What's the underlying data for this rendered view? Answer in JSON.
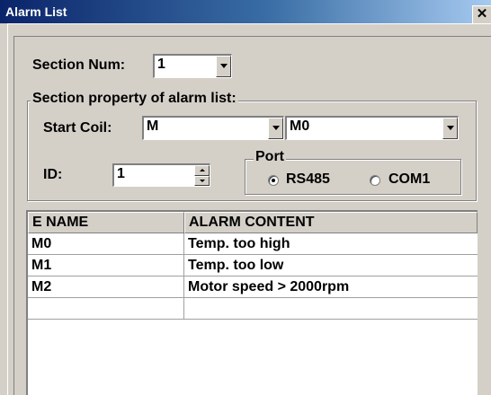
{
  "window": {
    "title": "Alarm List",
    "close_glyph": "✕"
  },
  "section_num": {
    "label": "Section Num:",
    "value": "1"
  },
  "section_property": {
    "group_title": "Section property of alarm list:",
    "start_coil_label": "Start Coil:",
    "start_coil_type": "M",
    "start_coil_address": "M0",
    "id_label": "ID:",
    "id_value": "1",
    "port": {
      "group_title": "Port",
      "options": [
        {
          "label": "RS485",
          "checked": true
        },
        {
          "label": "COM1",
          "checked": false
        }
      ]
    }
  },
  "table": {
    "columns": [
      "E NAME",
      "ALARM CONTENT"
    ],
    "rows": [
      [
        "M0",
        "Temp. too high"
      ],
      [
        "M1",
        "Temp. too low"
      ],
      [
        "M2",
        "Motor speed > 2000rpm"
      ],
      [
        "",
        ""
      ]
    ]
  }
}
